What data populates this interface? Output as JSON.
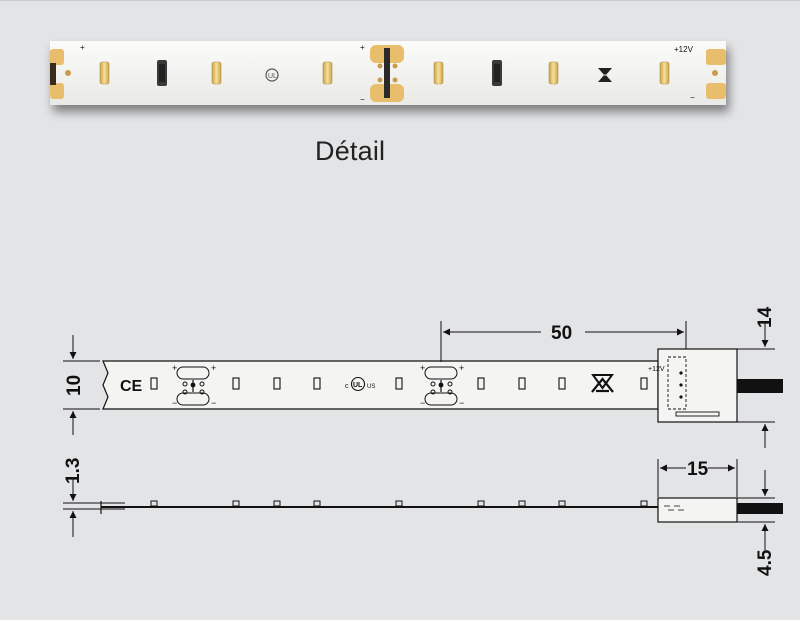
{
  "detail": {
    "caption": "Détail",
    "voltage_label": "+12V",
    "plus_sign": "+",
    "minus_sign": "−"
  },
  "drawing": {
    "dim_pitch": "50",
    "dim_width": "10",
    "dim_connector_height": "14",
    "dim_thickness": "1.3",
    "dim_connector_length": "15",
    "dim_connector_thickness": "4.5",
    "ce_mark": "CE",
    "ul_mark_c": "c",
    "ul_mark_ul": "UL",
    "ul_mark_us": "US",
    "voltage_label": "+12V",
    "plus_sign": "+",
    "minus_sign": "−"
  },
  "colors": {
    "background": "#e3e4e6",
    "strip_white": "#f4f4f2",
    "led_yellow": "#f2d27a",
    "pad_gold": "#e8bd6c",
    "line": "#111111"
  }
}
